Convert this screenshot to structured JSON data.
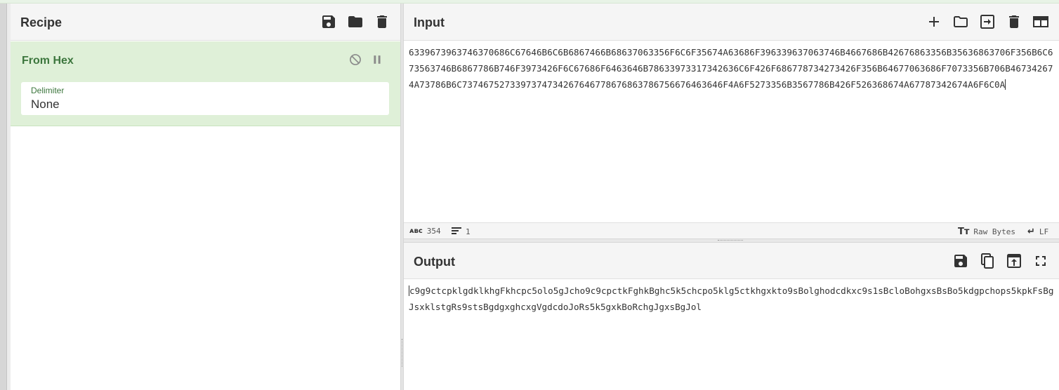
{
  "recipe": {
    "title": "Recipe",
    "icons": [
      "save-icon",
      "folder-icon",
      "trash-icon"
    ],
    "operation": {
      "name": "From Hex",
      "controls": [
        "disable-icon",
        "pause-icon"
      ],
      "delimiter_label": "Delimiter",
      "delimiter_value": "None"
    }
  },
  "input": {
    "title": "Input",
    "icons": [
      "plus-icon",
      "folder-icon",
      "import-icon",
      "trash-icon",
      "layout-icon"
    ],
    "text": "6339673963746370686C67646B6C6B6867466B68637063356F6C6F35674A63686F396339637063746B4667686B42676863356B35636863706F356B6C673563746B6867786B746F3973426F6C67686F6463646B78633973317342636C6F426F686778734273426F356B64677063686F7073356B706B467342674A73786B6C7374675273397374734267646778676863786756676463646F4A6F5273356B3567786B426F526368674A67787342674A6F6C0A",
    "status": {
      "char_count": "354",
      "line_count": "1",
      "encoding": "Raw Bytes",
      "eol": "LF"
    }
  },
  "output": {
    "title": "Output",
    "icons": [
      "save-icon",
      "copy-icon",
      "replace-input-icon",
      "maximize-icon"
    ],
    "text": "c9g9ctcpklgdklkhgFkhcpc5olo5gJcho9c9cpctkFghkBghc5k5chcpo5klg5ctkhgxkto9sBolghodcdkxc9s1sBcloBohgxsBsBo5kdgpchops5kpkFsBgJsxklstgRs9stsBgdgxghcxgVgdcdoJoRs5k5gxkBoRchgJgxsBgJol"
  },
  "colors": {
    "operation_bg": "#dff0d8",
    "operation_text": "#3c763d"
  }
}
